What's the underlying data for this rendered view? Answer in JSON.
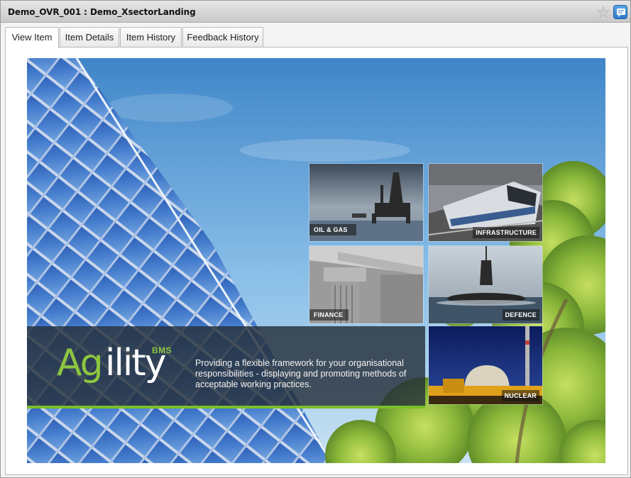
{
  "window": {
    "title": "Demo_OVR_001 : Demo_XsectorLanding"
  },
  "tabs": [
    {
      "label": "View Item",
      "active": true
    },
    {
      "label": "Item Details",
      "active": false
    },
    {
      "label": "Item History",
      "active": false
    },
    {
      "label": "Feedback History",
      "active": false
    }
  ],
  "hero": {
    "logo": {
      "part1": "Ag",
      "part2": "ility",
      "suffix": "BMS"
    },
    "tagline": "Providing a flexible framework for your organisational responsibilities -  displaying and promoting methods of acceptable working practices.",
    "tiles": [
      {
        "label": "OIL & GAS"
      },
      {
        "label": "INFRASTRUCTURE"
      },
      {
        "label": "FINANCE"
      },
      {
        "label": "DEFENCE"
      },
      {
        "label": "NUCLEAR"
      }
    ]
  },
  "icons": {
    "favourite": "star-icon",
    "feedback": "feedback-icon"
  },
  "colors": {
    "accent_green": "#8cc63f",
    "sky": "#6fa8dc",
    "titlebar": "#d4d4d4"
  }
}
